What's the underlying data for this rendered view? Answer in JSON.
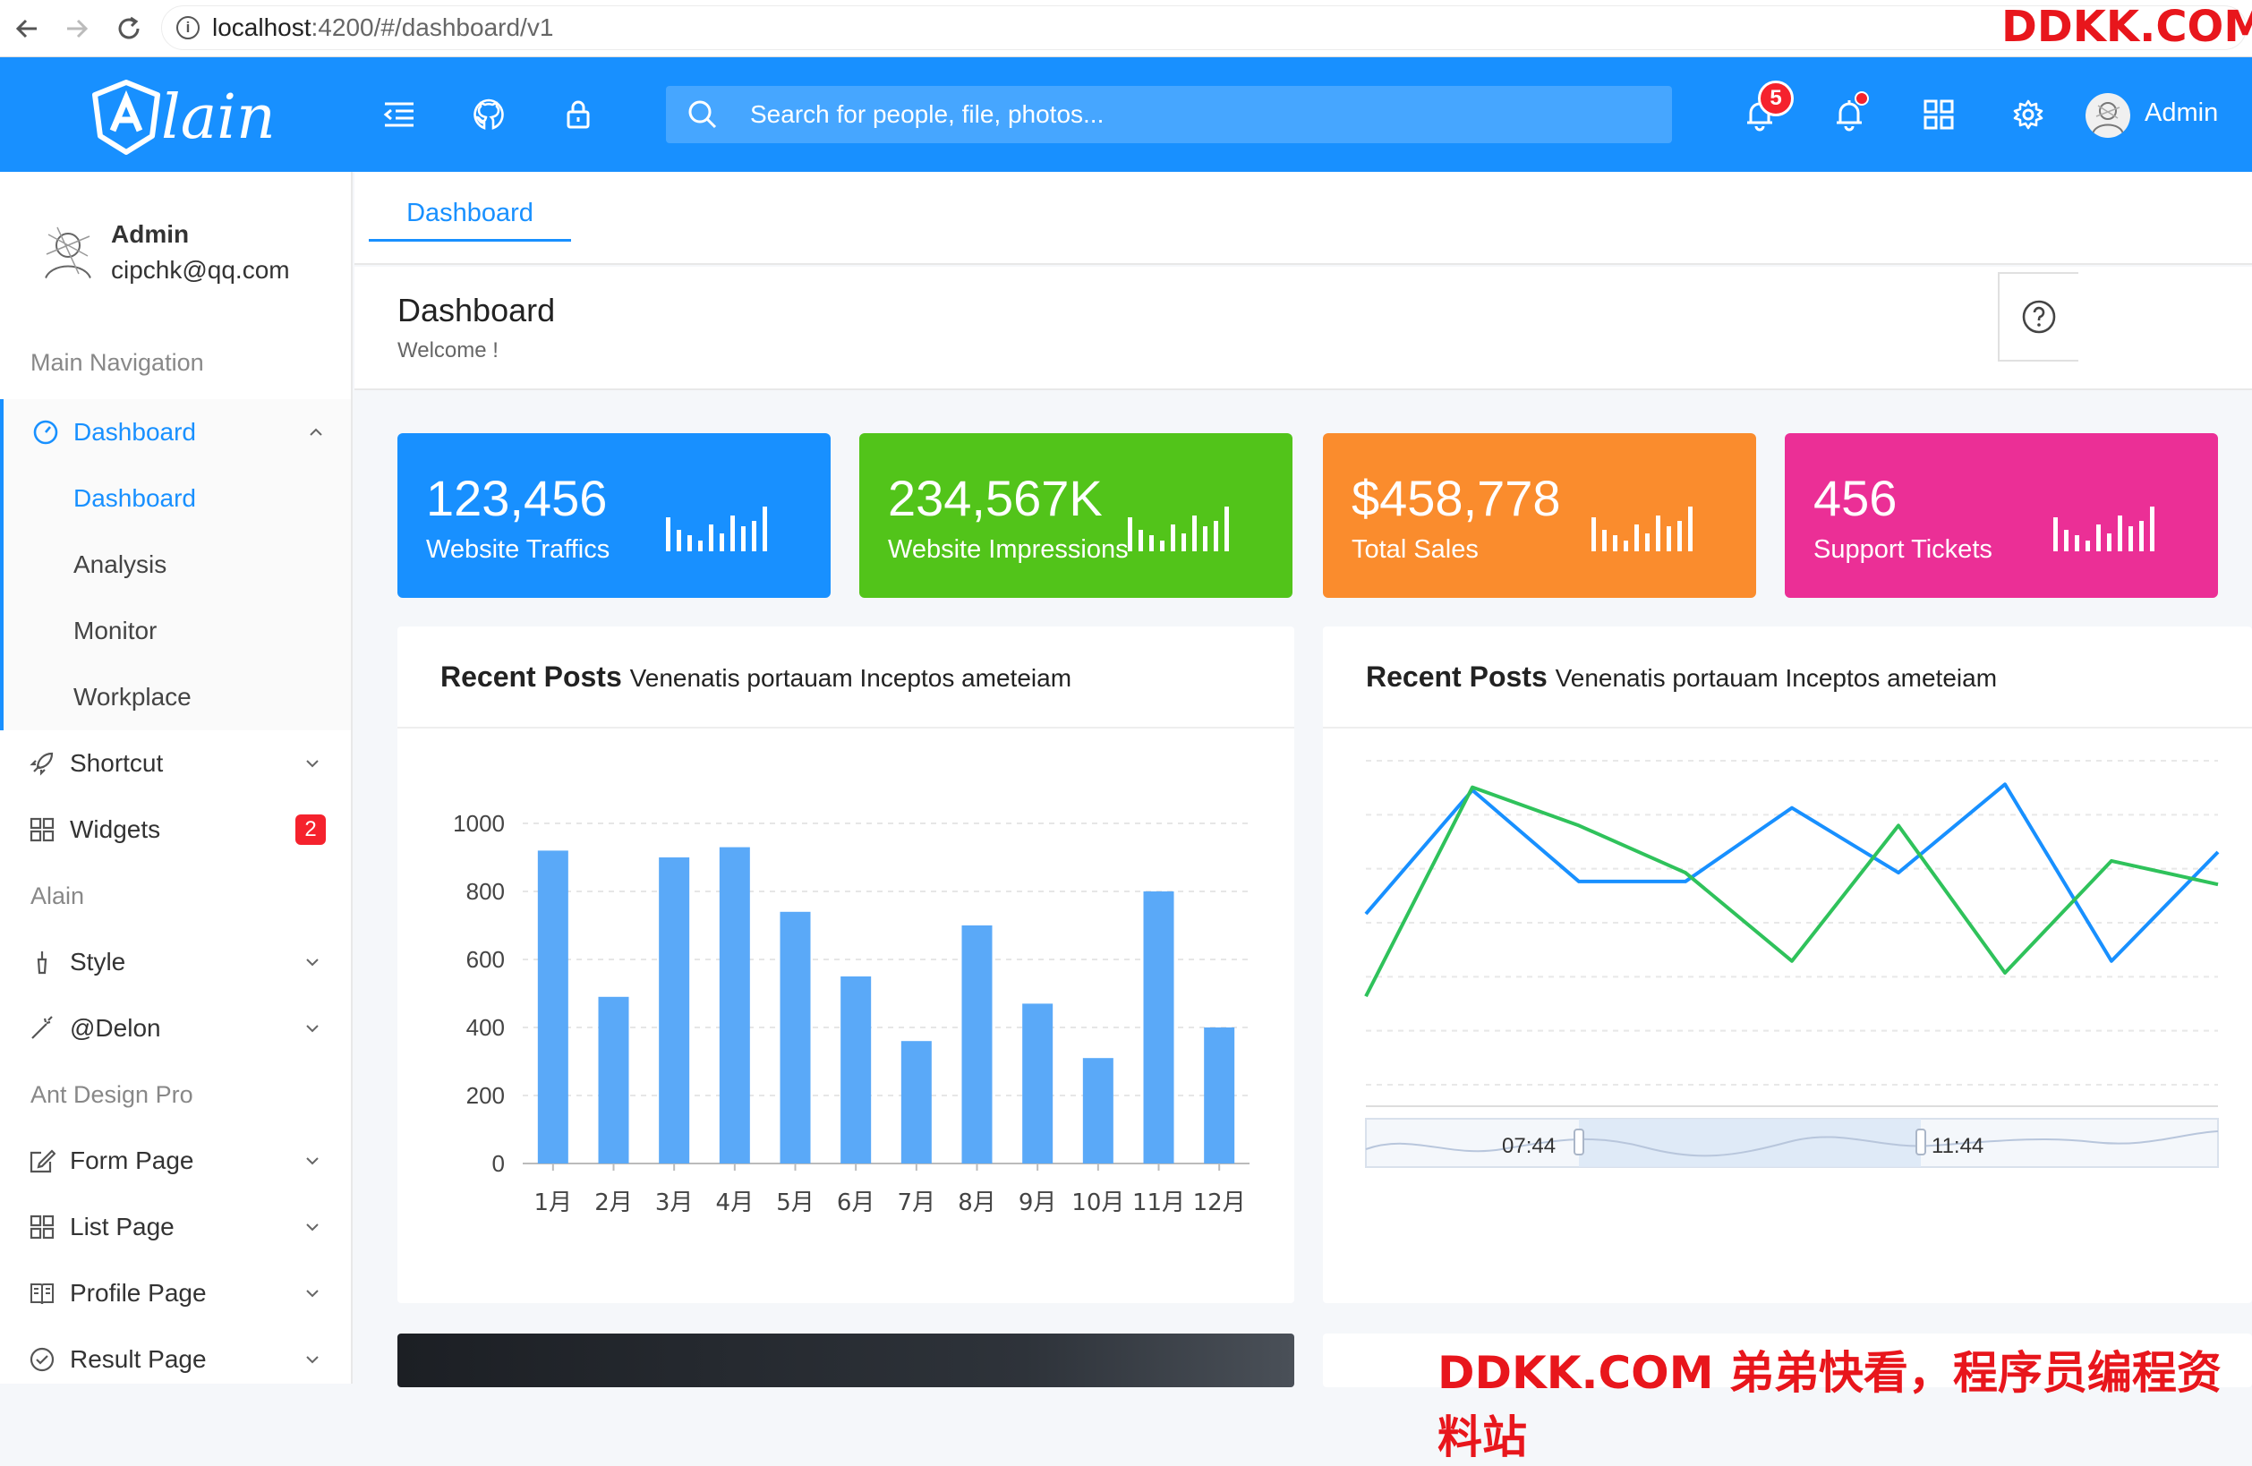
{
  "browser": {
    "url_host": "localhost",
    "url_path": ":4200/#/dashboard/v1"
  },
  "watermarks": {
    "top": "DDKK.COM",
    "bottom": "DDKK.COM 弟弟快看，程序员编程资料站"
  },
  "header": {
    "brand": "lain",
    "search_placeholder": "Search for people, file, photos...",
    "notification_count": "5",
    "user_name": "Admin"
  },
  "sidebar": {
    "user": {
      "name": "Admin",
      "email": "cipchk@qq.com"
    },
    "groups": [
      "Main Navigation",
      "Alain",
      "Ant Design Pro"
    ],
    "dashboard": {
      "label": "Dashboard",
      "children": [
        "Dashboard",
        "Analysis",
        "Monitor",
        "Workplace"
      ]
    },
    "items": {
      "shortcut": "Shortcut",
      "widgets": "Widgets",
      "widgets_badge": "2",
      "style": "Style",
      "delon": "@Delon",
      "form": "Form Page",
      "list": "List Page",
      "profile": "Profile Page",
      "result": "Result Page"
    }
  },
  "tabs": {
    "active": "Dashboard"
  },
  "page": {
    "title": "Dashboard",
    "subtitle": "Welcome !"
  },
  "stats": [
    {
      "value": "123,456",
      "label": "Website Traffics",
      "color": "#1890ff"
    },
    {
      "value": "234,567K",
      "label": "Website Impressions",
      "color": "#52c41a"
    },
    {
      "value": "$458,778",
      "label": "Total Sales",
      "color": "#fa8c2d"
    },
    {
      "value": "456",
      "label": "Support Tickets",
      "color": "#eb2f96"
    }
  ],
  "panels": [
    {
      "title": "Recent Posts",
      "subtitle": "Venenatis portauam Inceptos ameteiam"
    },
    {
      "title": "Recent Posts",
      "subtitle": "Venenatis portauam Inceptos ameteiam"
    }
  ],
  "chart_data": [
    {
      "type": "bar",
      "categories": [
        "1月",
        "2月",
        "3月",
        "4月",
        "5月",
        "6月",
        "7月",
        "8月",
        "9月",
        "10月",
        "11月",
        "12月"
      ],
      "values": [
        920,
        490,
        900,
        930,
        740,
        550,
        360,
        700,
        470,
        310,
        800,
        400
      ],
      "ylim": [
        0,
        1000
      ],
      "yticks": [
        0,
        200,
        400,
        600,
        800,
        1000
      ],
      "color": "#5aa9f8",
      "grid": true
    },
    {
      "type": "line",
      "series": [
        {
          "values": [
            580,
            1000,
            690,
            690,
            940,
            720,
            1020,
            420,
            790
          ]
        },
        {
          "values": [
            300,
            1010,
            880,
            720,
            420,
            880,
            380,
            760,
            680
          ]
        }
      ],
      "colors": [
        "#1890ff",
        "#2fc25b"
      ],
      "ylim": [
        0,
        1100
      ],
      "grid": true,
      "slider": {
        "start_label": "07:44",
        "end_label": "11:44"
      }
    }
  ]
}
